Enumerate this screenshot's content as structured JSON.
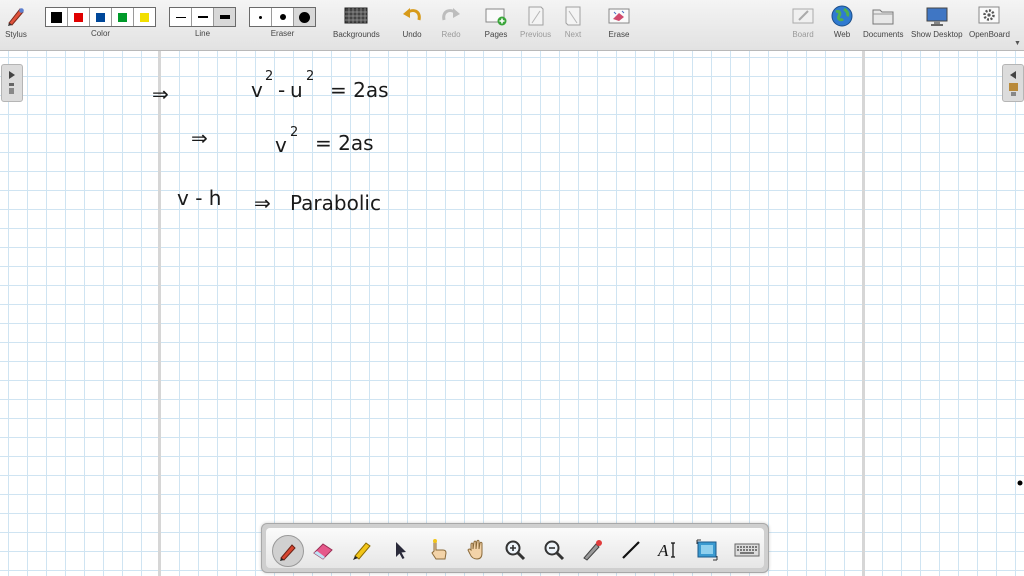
{
  "toolbar": {
    "stylus": "Stylus",
    "color": "Color",
    "line": "Line",
    "eraser": "Eraser",
    "backgrounds": "Backgrounds",
    "undo": "Undo",
    "redo": "Redo",
    "pages": "Pages",
    "previous": "Previous",
    "next": "Next",
    "erase": "Erase",
    "board": "Board",
    "web": "Web",
    "documents": "Documents",
    "show_desktop": "Show Desktop",
    "openboard": "OpenBoard",
    "colors": [
      "#000000",
      "#e00000",
      "#00489a",
      "#009a2a",
      "#f2df00"
    ]
  },
  "board": {
    "line1_arrow": "⇒",
    "line1_v": "v",
    "line1_v_exp": "2",
    "line1_minus": "-",
    "line1_u": "u",
    "line1_u_exp": "2",
    "line1_rhs": "= 2as",
    "line2_arrow": "⇒",
    "line2_v": "v",
    "line2_v_exp": "2",
    "line2_rhs": "= 2as",
    "line3_lhs": "v - h",
    "line3_arrow": "⇒",
    "line3_rhs": "Parabolic"
  },
  "palette": {
    "tools": [
      "pen",
      "eraser",
      "highlighter",
      "selector",
      "interactor",
      "hand",
      "zoom-in",
      "zoom-out",
      "laser-pointer",
      "line",
      "text",
      "capture",
      "keyboard"
    ]
  }
}
